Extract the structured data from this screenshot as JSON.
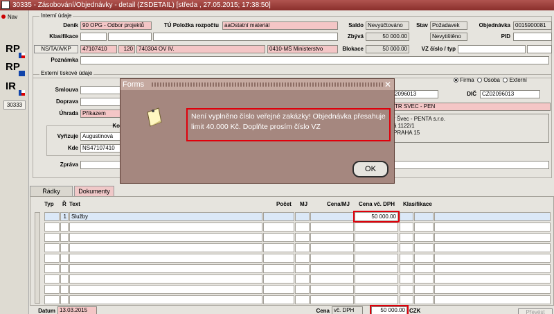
{
  "window": {
    "title": "30335 - Zásobování/Objednávky - detail (ZSDETAIL) [středa , 27.05.2015; 17:38:50]"
  },
  "sidebar": {
    "nav_label": "Nav",
    "icons": [
      "RP",
      "RP",
      "IR"
    ],
    "number": "30333"
  },
  "header": {
    "section_internal": "Interní údaje",
    "denik_label": "Deník",
    "denik_value": "90 OPG - Odbor projektů",
    "tu_label": "TÚ Položka rozpočtu",
    "tu_value": "aaOstatní materiál",
    "klasifikace_label": "Klasifikace",
    "ns_button": "NS/TA/A/KP",
    "ns_value1": "47107410",
    "ns_value2": "120",
    "ns_value3": "740304 OV IV.",
    "ministry": "0410-MŠ Ministerstvo",
    "poznamka_label": "Poznámka",
    "saldo_label": "Saldo",
    "saldo_value": "Nevyúčtováno",
    "stav_label": "Stav",
    "stav_value": "Požadavek",
    "objednavka_label": "Objednávka",
    "objednavka_value": "0015900081",
    "zbyva_label": "Zbývá",
    "zbyva_value": "50 000.00",
    "stav2_value": "Nevytištěno",
    "pid_label": "PID",
    "blokace_label": "Blokace",
    "blokace_value": "50 000.00",
    "vz_label": "VZ číslo / typ"
  },
  "external": {
    "section": "Externí tiskové údaje",
    "radio_firma": "Firma",
    "radio_osoba": "Osoba",
    "radio_externi": "Externí",
    "smlouva_label": "Smlouva",
    "doprava_label": "Doprava",
    "uhrada_label": "Úhrada",
    "uhrada_value": "Příkazem",
    "ko_label": "Ko",
    "vyrizuje_label": "Vyřizuje",
    "vyrizuje_value": "Augustinová",
    "kde_label": "Kde",
    "kde_value": "NS47107410",
    "zprava_label": "Zpráva",
    "ico_value": "2096013",
    "dic_label": "DIČ",
    "dic_value": "CZ02096013",
    "supplier_name": "TR SVEC - PEN",
    "addr1": "r Švec - PENTA s.r.o.",
    "addr2": "á 1122/1",
    "addr3": "PRAHA 15"
  },
  "tabs": [
    {
      "label": "Řádky"
    },
    {
      "label": "Dokumenty"
    }
  ],
  "grid": {
    "headers": {
      "typ": "Typ",
      "r": "Ř",
      "text": "Text",
      "pocet": "Počet",
      "mj": "MJ",
      "cena_mj": "Cena/MJ",
      "cena_vc_dph": "Cena vč. DPH",
      "klasifikace": "Klasifikace"
    },
    "rows": [
      {
        "r": "1",
        "text": "Služby",
        "cena_vc_dph": "50 000.00"
      }
    ]
  },
  "footer": {
    "datum_label": "Datum",
    "datum_value": "13.03.2015",
    "cena_label": "Cena",
    "cena_type": "vč. DPH",
    "cena_value": "50 000.00",
    "currency": "CZK",
    "right_btn": "Převést"
  },
  "dialog": {
    "title": "Forms",
    "message": "Není vyplněno číslo veřejné zakázky! Objednávka přesahuje limit 40.000 Kč. Doplňte prosím číslo VZ",
    "ok_label": "OK"
  }
}
